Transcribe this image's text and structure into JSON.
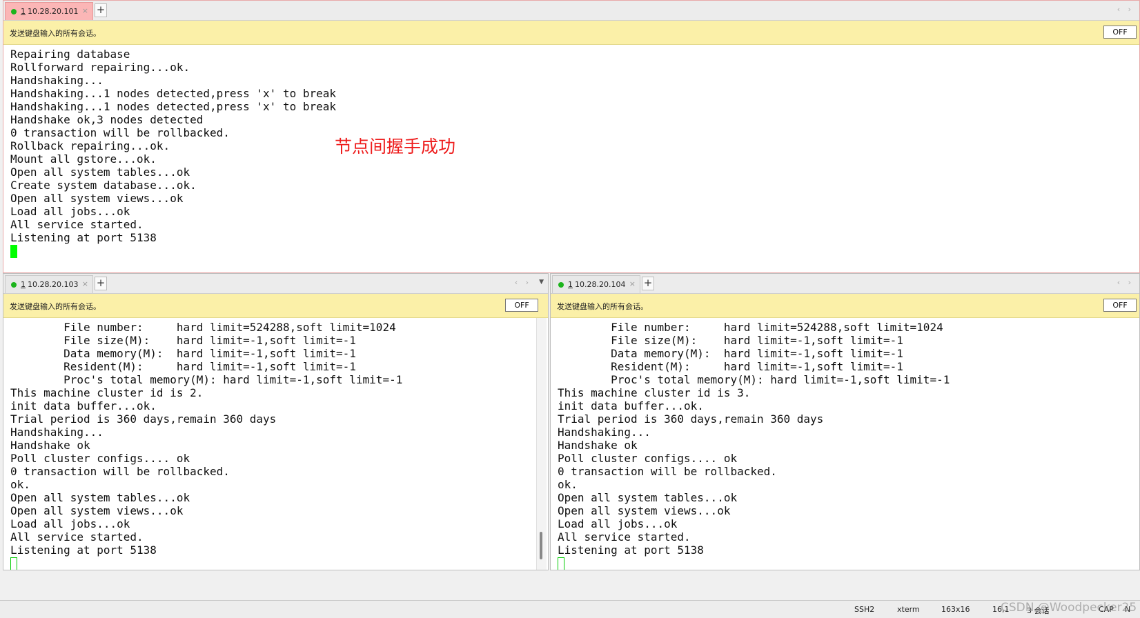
{
  "top_pane": {
    "tab": {
      "number": "1",
      "host": "10.28.20.101",
      "close": "×"
    },
    "new_tab": "+",
    "nav": "‹ ›",
    "broadcast_label": "发送键盘输入的所有会话。",
    "off_label": "OFF",
    "lines": [
      "Repairing database",
      "Rollforward repairing...ok.",
      "Handshaking...",
      "Handshaking...1 nodes detected,press 'x' to break",
      "Handshaking...1 nodes detected,press 'x' to break",
      "Handshake ok,3 nodes detected",
      "0 transaction will be rollbacked.",
      "Rollback repairing...ok.",
      "Mount all gstore...ok.",
      "Open all system tables...ok",
      "Create system database...ok.",
      "Open all system views...ok",
      "Load all jobs...ok",
      "All service started.",
      "Listening at port 5138"
    ],
    "annotation": "节点间握手成功"
  },
  "left_pane": {
    "tab": {
      "number": "1",
      "host": "10.28.20.103",
      "close": "×"
    },
    "new_tab": "+",
    "nav": "‹ ›",
    "menu_arrow": "▼",
    "broadcast_label": "发送键盘输入的所有会话。",
    "off_label": "OFF",
    "lines": [
      "        File number:     hard limit=524288,soft limit=1024",
      "        File size(M):    hard limit=-1,soft limit=-1",
      "        Data memory(M):  hard limit=-1,soft limit=-1",
      "        Resident(M):     hard limit=-1,soft limit=-1",
      "        Proc's total memory(M): hard limit=-1,soft limit=-1",
      "This machine cluster id is 2.",
      "init data buffer...ok.",
      "Trial period is 360 days,remain 360 days",
      "Handshaking...",
      "Handshake ok",
      "Poll cluster configs.... ok",
      "0 transaction will be rollbacked.",
      "ok.",
      "Open all system tables...ok",
      "Open all system views...ok",
      "Load all jobs...ok",
      "All service started.",
      "Listening at port 5138"
    ]
  },
  "right_pane": {
    "tab": {
      "number": "1",
      "host": "10.28.20.104",
      "close": "×"
    },
    "new_tab": "+",
    "nav": "‹ ›",
    "broadcast_label": "发送键盘输入的所有会话。",
    "off_label": "OFF",
    "lines": [
      "        File number:     hard limit=524288,soft limit=1024",
      "        File size(M):    hard limit=-1,soft limit=-1",
      "        Data memory(M):  hard limit=-1,soft limit=-1",
      "        Resident(M):     hard limit=-1,soft limit=-1",
      "        Proc's total memory(M): hard limit=-1,soft limit=-1",
      "This machine cluster id is 3.",
      "init data buffer...ok.",
      "Trial period is 360 days,remain 360 days",
      "Handshaking...",
      "Handshake ok",
      "Poll cluster configs.... ok",
      "0 transaction will be rollbacked.",
      "ok.",
      "Open all system tables...ok",
      "Open all system views...ok",
      "Load all jobs...ok",
      "All service started.",
      "Listening at port 5138"
    ]
  },
  "statusbar": {
    "protocol": "SSH2",
    "terminal": "xterm",
    "size": "163x16",
    "position": "16,1",
    "sessions": "3 会话",
    "caps": "CAP",
    "num": "N",
    "watermark": "CSDN @Woodpecker25"
  },
  "colors": {
    "cursor": "#00ff00",
    "broadcast_bar": "#fbf0a8",
    "active_tab": "#fbb6b6",
    "annotation": "#ee1c1c"
  }
}
